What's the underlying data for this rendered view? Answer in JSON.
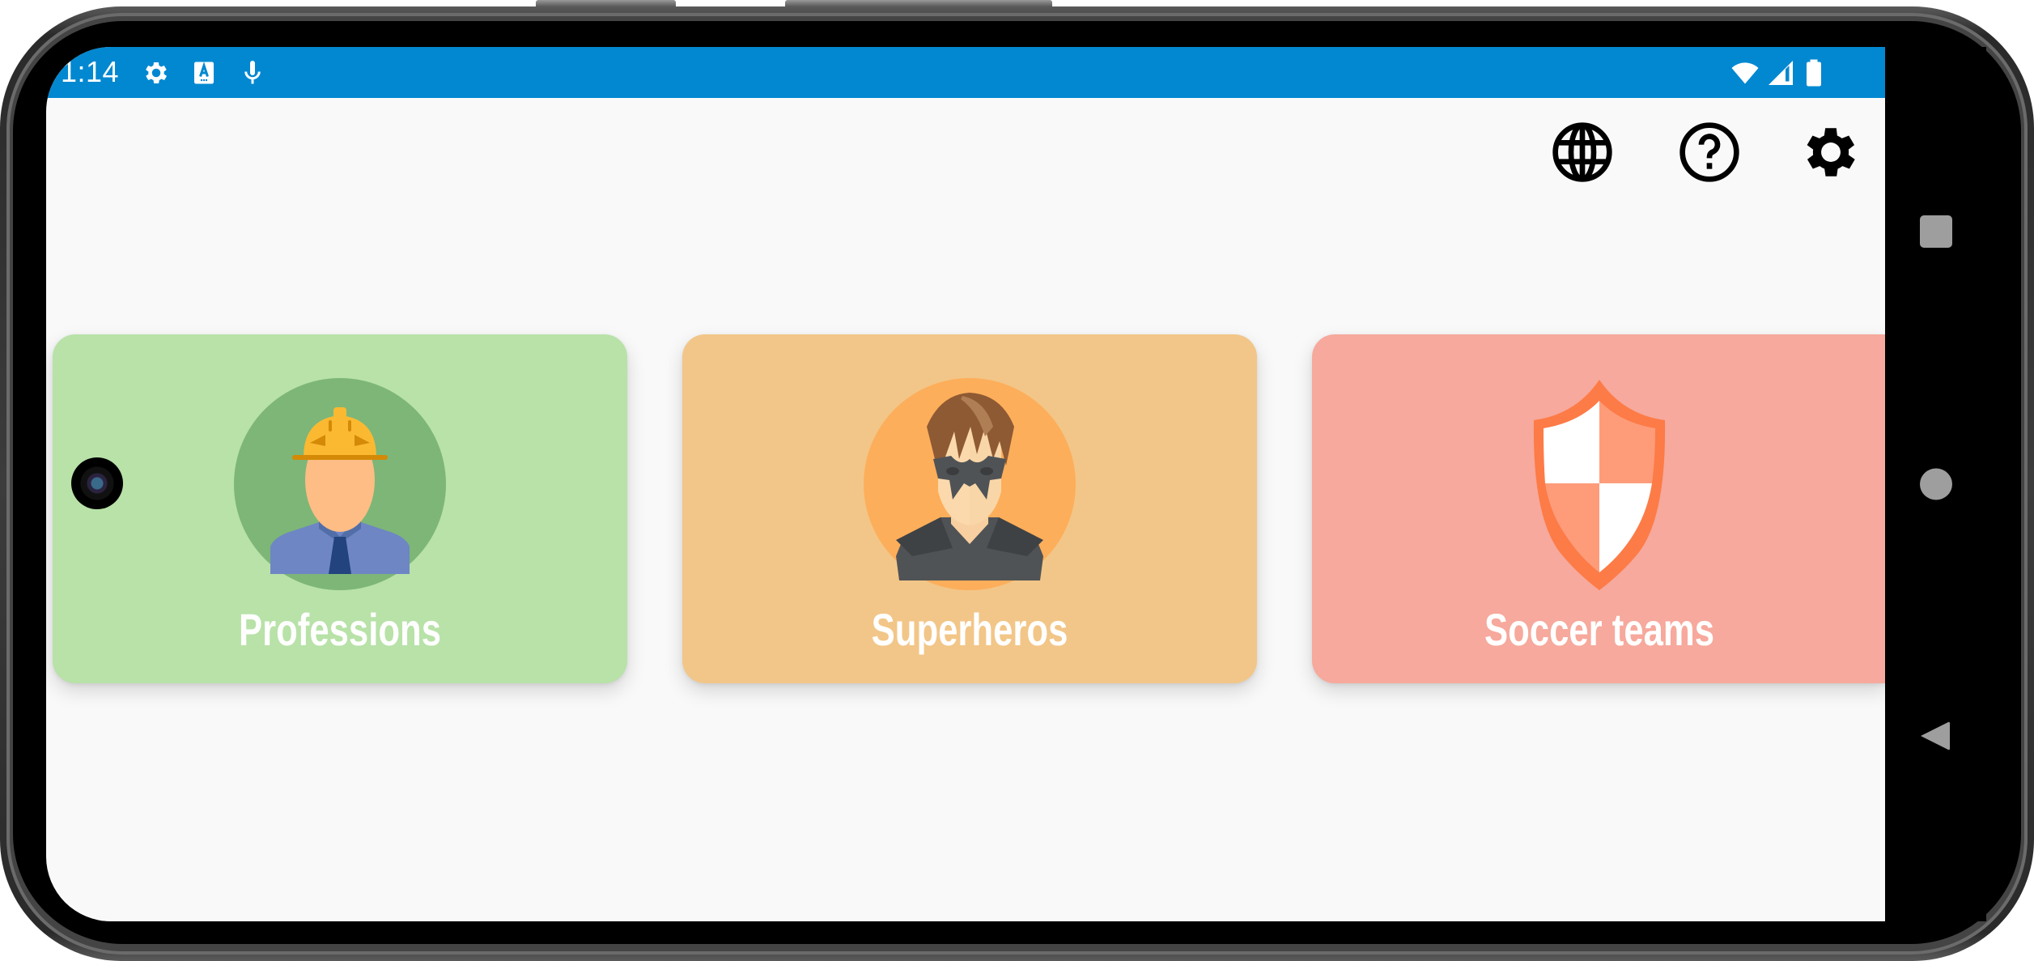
{
  "status_bar": {
    "time": "1:14",
    "left_icons": [
      "settings-icon",
      "text-a-icon",
      "microphone-icon"
    ],
    "right_icons": [
      "wifi-icon",
      "signal-icon",
      "battery-icon"
    ],
    "color": "#0288d1"
  },
  "toolbar": {
    "actions": [
      {
        "name": "language",
        "icon": "globe-icon"
      },
      {
        "name": "help",
        "icon": "help-circle-icon"
      },
      {
        "name": "settings",
        "icon": "gear-icon"
      }
    ]
  },
  "categories": [
    {
      "label": "Professions",
      "icon": "construction-worker-icon",
      "bg": "#b8e2a8",
      "circle": "#7db677"
    },
    {
      "label": "Superheros",
      "icon": "masked-hero-icon",
      "bg": "#f2c688",
      "circle": "#fdae5a"
    },
    {
      "label": "Soccer teams",
      "icon": "shield-crest-icon",
      "bg": "#f6a99c",
      "circle": null
    }
  ],
  "nav_bar": {
    "buttons": [
      "recents",
      "home",
      "back"
    ]
  }
}
